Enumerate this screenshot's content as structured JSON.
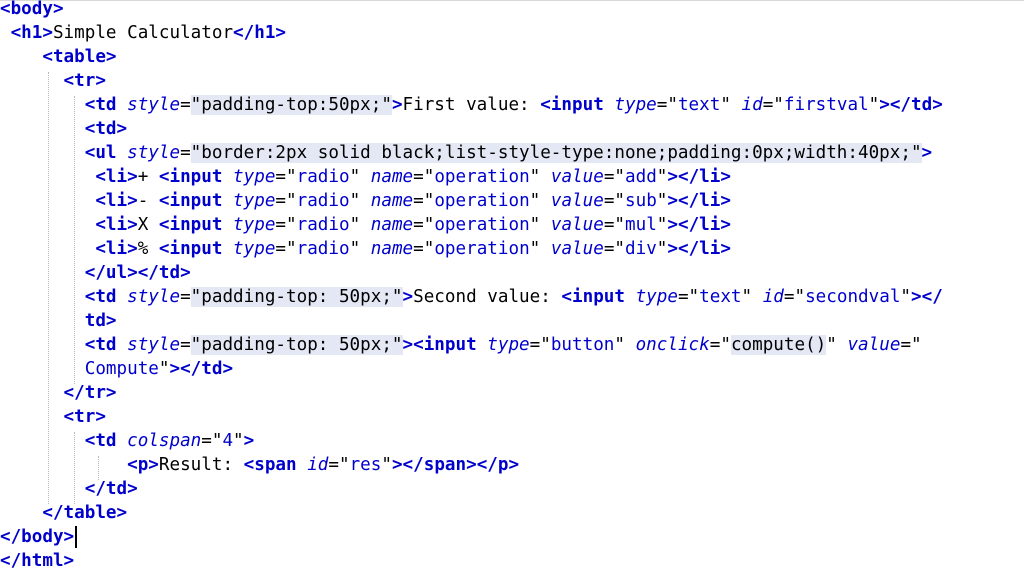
{
  "editor": {
    "lines": [
      [
        [
          "tag",
          "<body>"
        ]
      ],
      [
        [
          "tag",
          " <h1>"
        ],
        [
          "text",
          "Simple Calculator"
        ],
        [
          "tag",
          "</h1>"
        ]
      ],
      [
        [
          "tag",
          "    <table>"
        ]
      ],
      [
        [
          "tag",
          "      <tr>"
        ]
      ],
      [
        [
          "tag",
          "        <td "
        ],
        [
          "attr",
          "style"
        ],
        [
          "text",
          "="
        ],
        [
          "hl",
          "\"padding-top:50px;\""
        ],
        [
          "tag",
          ">"
        ],
        [
          "text",
          "First value: "
        ],
        [
          "tag",
          "<input "
        ],
        [
          "attr",
          "type"
        ],
        [
          "text",
          "=\""
        ],
        [
          "val",
          "text"
        ],
        [
          "text",
          "\" "
        ],
        [
          "attr",
          "id"
        ],
        [
          "text",
          "=\""
        ],
        [
          "val",
          "firstval"
        ],
        [
          "text",
          "\""
        ],
        [
          "tag",
          "></td>"
        ]
      ],
      [
        [
          "tag",
          "        <td>"
        ]
      ],
      [
        [
          "tag",
          "        <ul "
        ],
        [
          "attr",
          "style"
        ],
        [
          "text",
          "="
        ],
        [
          "hl",
          "\"border:2px solid black;list-style-type:none;padding:0px;width:40px;\""
        ],
        [
          "tag",
          ">"
        ]
      ],
      [
        [
          "tag",
          "         <li>"
        ],
        [
          "text",
          "+ "
        ],
        [
          "tag",
          "<input "
        ],
        [
          "attr",
          "type"
        ],
        [
          "text",
          "=\""
        ],
        [
          "val",
          "radio"
        ],
        [
          "text",
          "\" "
        ],
        [
          "attr",
          "name"
        ],
        [
          "text",
          "=\""
        ],
        [
          "val",
          "operation"
        ],
        [
          "text",
          "\" "
        ],
        [
          "attr",
          "value"
        ],
        [
          "text",
          "=\""
        ],
        [
          "val",
          "add"
        ],
        [
          "text",
          "\""
        ],
        [
          "tag",
          "></li>"
        ]
      ],
      [
        [
          "tag",
          "         <li>"
        ],
        [
          "text",
          "- "
        ],
        [
          "tag",
          "<input "
        ],
        [
          "attr",
          "type"
        ],
        [
          "text",
          "=\""
        ],
        [
          "val",
          "radio"
        ],
        [
          "text",
          "\" "
        ],
        [
          "attr",
          "name"
        ],
        [
          "text",
          "=\""
        ],
        [
          "val",
          "operation"
        ],
        [
          "text",
          "\" "
        ],
        [
          "attr",
          "value"
        ],
        [
          "text",
          "=\""
        ],
        [
          "val",
          "sub"
        ],
        [
          "text",
          "\""
        ],
        [
          "tag",
          "></li>"
        ]
      ],
      [
        [
          "tag",
          "         <li>"
        ],
        [
          "text",
          "X "
        ],
        [
          "tag",
          "<input "
        ],
        [
          "attr",
          "type"
        ],
        [
          "text",
          "=\""
        ],
        [
          "val",
          "radio"
        ],
        [
          "text",
          "\" "
        ],
        [
          "attr",
          "name"
        ],
        [
          "text",
          "=\""
        ],
        [
          "val",
          "operation"
        ],
        [
          "text",
          "\" "
        ],
        [
          "attr",
          "value"
        ],
        [
          "text",
          "=\""
        ],
        [
          "val",
          "mul"
        ],
        [
          "text",
          "\""
        ],
        [
          "tag",
          "></li>"
        ]
      ],
      [
        [
          "tag",
          "         <li>"
        ],
        [
          "text",
          "% "
        ],
        [
          "tag",
          "<input "
        ],
        [
          "attr",
          "type"
        ],
        [
          "text",
          "=\""
        ],
        [
          "val",
          "radio"
        ],
        [
          "text",
          "\" "
        ],
        [
          "attr",
          "name"
        ],
        [
          "text",
          "=\""
        ],
        [
          "val",
          "operation"
        ],
        [
          "text",
          "\" "
        ],
        [
          "attr",
          "value"
        ],
        [
          "text",
          "=\""
        ],
        [
          "val",
          "div"
        ],
        [
          "text",
          "\""
        ],
        [
          "tag",
          "></li>"
        ]
      ],
      [
        [
          "tag",
          "        </ul></td>"
        ]
      ],
      [
        [
          "tag",
          "        <td "
        ],
        [
          "attr",
          "style"
        ],
        [
          "text",
          "="
        ],
        [
          "hl",
          "\"padding-top: 50px;\""
        ],
        [
          "tag",
          ">"
        ],
        [
          "text",
          "Second value: "
        ],
        [
          "tag",
          "<input "
        ],
        [
          "attr",
          "type"
        ],
        [
          "text",
          "=\""
        ],
        [
          "val",
          "text"
        ],
        [
          "text",
          "\" "
        ],
        [
          "attr",
          "id"
        ],
        [
          "text",
          "=\""
        ],
        [
          "val",
          "secondval"
        ],
        [
          "text",
          "\""
        ],
        [
          "tag",
          "></"
        ]
      ],
      [
        [
          "tag",
          "        td>"
        ]
      ],
      [
        [
          "tag",
          "        <td "
        ],
        [
          "attr",
          "style"
        ],
        [
          "text",
          "="
        ],
        [
          "hl",
          "\"padding-top: 50px;\""
        ],
        [
          "tag",
          ">"
        ],
        [
          "tag",
          "<input "
        ],
        [
          "attr",
          "type"
        ],
        [
          "text",
          "=\""
        ],
        [
          "val",
          "button"
        ],
        [
          "text",
          "\" "
        ],
        [
          "attr",
          "onclick"
        ],
        [
          "text",
          "=\""
        ],
        [
          "hl",
          "compute()"
        ],
        [
          "text",
          "\" "
        ],
        [
          "attr",
          "value"
        ],
        [
          "text",
          "=\""
        ]
      ],
      [
        [
          "val",
          "        Compute"
        ],
        [
          "text",
          "\""
        ],
        [
          "tag",
          "></td>"
        ]
      ],
      [
        [
          "tag",
          "      </tr>"
        ]
      ],
      [
        [
          "tag",
          "      <tr>"
        ]
      ],
      [
        [
          "tag",
          "        <td "
        ],
        [
          "attr",
          "colspan"
        ],
        [
          "text",
          "=\""
        ],
        [
          "val",
          "4"
        ],
        [
          "text",
          "\""
        ],
        [
          "tag",
          ">"
        ]
      ],
      [
        [
          "tag",
          "            <p>"
        ],
        [
          "text",
          "Result: "
        ],
        [
          "tag",
          "<span "
        ],
        [
          "attr",
          "id"
        ],
        [
          "text",
          "=\""
        ],
        [
          "val",
          "res"
        ],
        [
          "text",
          "\""
        ],
        [
          "tag",
          "></span></p>"
        ]
      ],
      [
        [
          "tag",
          "        </td>"
        ]
      ],
      [
        [
          "tag",
          "    </table>"
        ]
      ],
      [
        [
          "tag",
          "</body>"
        ],
        [
          "caret",
          ""
        ]
      ],
      [
        [
          "tag",
          "</html>"
        ]
      ]
    ]
  }
}
